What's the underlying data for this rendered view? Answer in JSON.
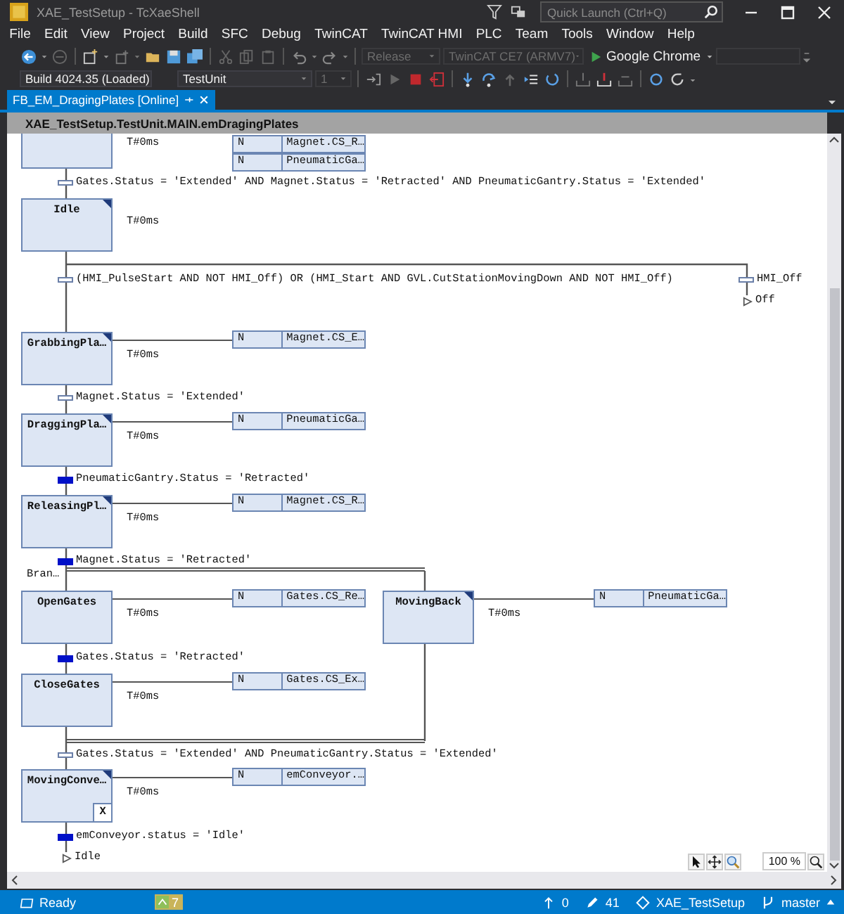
{
  "window": {
    "title": "XAE_TestSetup - TcXaeShell"
  },
  "quick_launch": {
    "placeholder": "Quick Launch (Ctrl+Q)"
  },
  "menu": [
    "File",
    "Edit",
    "View",
    "Project",
    "Build",
    "SFC",
    "Debug",
    "TwinCAT",
    "TwinCAT HMI",
    "PLC",
    "Team",
    "Tools",
    "Window",
    "Help"
  ],
  "toolbar_1": {
    "combos": [
      {
        "text": "Release",
        "disabled": true
      },
      {
        "text": "TwinCAT CE7 (ARMV7)",
        "disabled": true
      }
    ],
    "run_target": "Google Chrome"
  },
  "toolbar_2": {
    "combos": [
      {
        "text": "Build 4024.35 (Loaded)",
        "disabled": false
      },
      {
        "text": "TestUnit",
        "disabled": false
      },
      {
        "text": "1",
        "disabled": true
      }
    ]
  },
  "document_tab": {
    "label": "FB_EM_DragingPlates [Online]",
    "selected": true
  },
  "breadcrumb": "XAE_TestSetup.TestUnit.MAIN.emDragingPlates",
  "sfc": {
    "steps": [
      {
        "time": "T#0ms",
        "actions": [
          {
            "qualifier": "N",
            "name": "Magnet.CS_R…"
          },
          {
            "qualifier": "N",
            "name": "PneumaticGa…"
          }
        ]
      },
      {
        "name": "Idle",
        "time": "T#0ms",
        "marked": true
      },
      {
        "name": "GrabbingPla…",
        "time": "T#0ms",
        "marked": true,
        "actions": [
          {
            "qualifier": "N",
            "name": "Magnet.CS_E…"
          }
        ]
      },
      {
        "name": "DraggingPla…",
        "time": "T#0ms",
        "marked": true,
        "actions": [
          {
            "qualifier": "N",
            "name": "PneumaticGa…"
          }
        ]
      },
      {
        "name": "ReleasingPl…",
        "time": "T#0ms",
        "marked": true,
        "actions": [
          {
            "qualifier": "N",
            "name": "Magnet.CS_R…"
          }
        ]
      },
      {
        "name": "OpenGates",
        "time": "T#0ms",
        "marked": false,
        "actions": [
          {
            "qualifier": "N",
            "name": "Gates.CS_Re…"
          }
        ]
      },
      {
        "name": "MovingBack",
        "time": "T#0ms",
        "marked": true,
        "actions": [
          {
            "qualifier": "N",
            "name": "PneumaticGa…"
          }
        ]
      },
      {
        "name": "CloseGates",
        "time": "T#0ms",
        "marked": false,
        "actions": [
          {
            "qualifier": "N",
            "name": "Gates.CS_Ex…"
          }
        ]
      },
      {
        "name": "MovingConve…",
        "time": "T#0ms",
        "marked": true,
        "exit_marker": "X",
        "actions": [
          {
            "qualifier": "N",
            "name": "emConveyor.…"
          }
        ]
      }
    ],
    "transitions": [
      {
        "condition": "Gates.Status = 'Extended' AND Magnet.Status = 'Retracted' AND PneumaticGantry.Status = 'Extended'",
        "true": false
      },
      {
        "condition": "(HMI_PulseStart AND NOT HMI_Off) OR (HMI_Start AND GVL.CutStationMovingDown AND NOT HMI_Off)",
        "true": false
      },
      {
        "condition": "HMI_Off",
        "true": false
      },
      {
        "condition": "Magnet.Status = 'Extended'",
        "true": false
      },
      {
        "condition": "PneumaticGantry.Status = 'Retracted'",
        "true": true
      },
      {
        "condition": "Magnet.Status = 'Retracted'",
        "true": true
      },
      {
        "condition": "Gates.Status = 'Retracted'",
        "true": true
      },
      {
        "condition": "Gates.Status = 'Extended' AND PneumaticGantry.Status = 'Extended'",
        "true": false
      },
      {
        "condition": "emConveyor.status = 'Idle'",
        "true": true
      }
    ],
    "jumps": [
      "Off",
      "Idle"
    ],
    "branch_label": "Bran…"
  },
  "zoom_level": "100 %",
  "status_bar": {
    "text": "Ready",
    "badge": "7",
    "unpushed": "0",
    "changes": "41",
    "repository": "XAE_TestSetup",
    "branch": "master"
  }
}
